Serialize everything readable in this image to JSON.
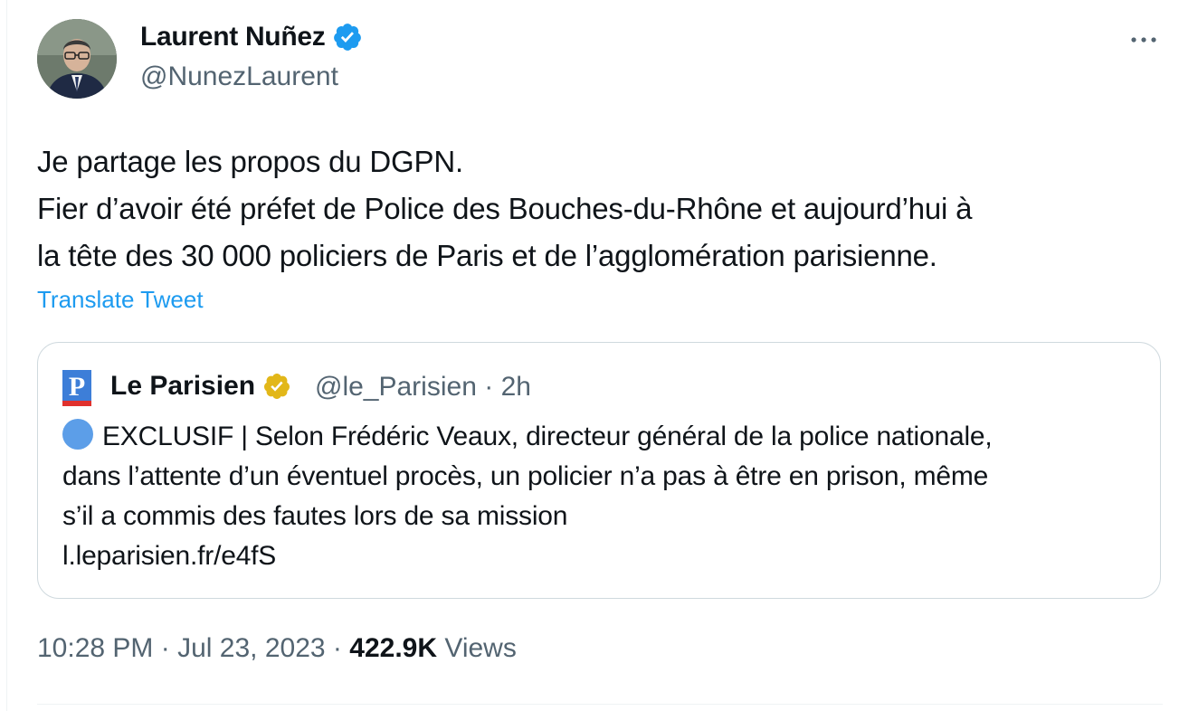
{
  "author": {
    "display_name": "Laurent Nuñez",
    "handle": "@NunezLaurent",
    "avatar_icon": "profile-photo",
    "verified_icon": "verified-badge-blue-icon"
  },
  "tweet": {
    "lines": [
      "Je partage les propos du DGPN.",
      "Fier d’avoir été préfet de Police des Bouches-du-Rhône et aujourd’hui à",
      "la tête des 30 000 policiers de Paris et de l’agglomération parisienne."
    ],
    "translate_label": "Translate Tweet"
  },
  "quoted_tweet": {
    "display_name": "Le Parisien",
    "handle": "@le_Parisien",
    "separator": "·",
    "age": "2h",
    "logo_letter": "P",
    "verified_icon": "verified-badge-gold-icon",
    "body_lines": [
      "EXCLUSIF | Selon Frédéric Veaux, directeur général de la police nationale,",
      "dans l’attente d’un éventuel procès, un policier n’a pas à être en prison, même",
      "s’il a commis des fautes lors de sa mission",
      "l.leparisien.fr/e4fS"
    ],
    "emoji": "blue-circle"
  },
  "footer": {
    "time": "10:28 PM",
    "separator1": "·",
    "date": "Jul 23, 2023",
    "separator2": "·",
    "views_count": "422.9K",
    "views_label": "Views"
  },
  "colors": {
    "text": "#0f1419",
    "secondary": "#536471",
    "link": "#1d9bf0",
    "border": "#cfd9de",
    "verified_blue": "#1d9bf0",
    "verified_gold": "#e2b719",
    "parisien_blue": "#3d7ed8",
    "parisien_red": "#e0312d"
  }
}
